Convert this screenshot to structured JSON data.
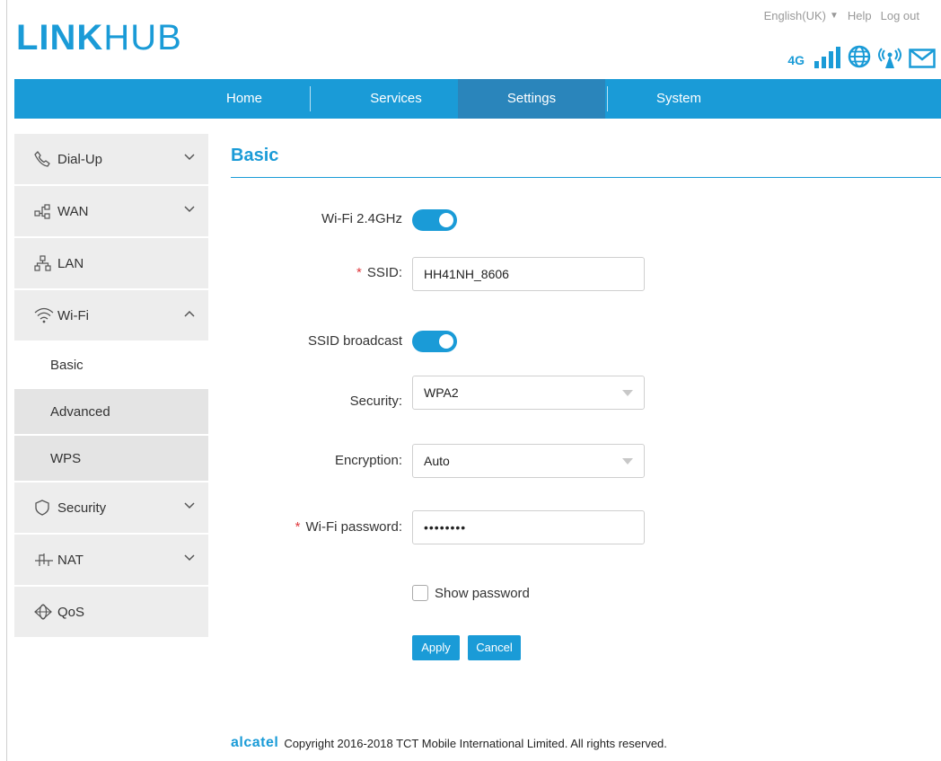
{
  "header": {
    "logo_bold": "LINK",
    "logo_light": "HUB",
    "language": "English(UK)",
    "help": "Help",
    "logout": "Log out",
    "network_type": "4G"
  },
  "nav": {
    "items": [
      {
        "label": "Home"
      },
      {
        "label": "Services"
      },
      {
        "label": "Settings"
      },
      {
        "label": "System"
      }
    ],
    "active": "Settings"
  },
  "sidebar": {
    "items": [
      {
        "label": "Dial-Up",
        "icon": "phone-icon"
      },
      {
        "label": "WAN",
        "icon": "wan-icon"
      },
      {
        "label": "LAN",
        "icon": "lan-icon"
      },
      {
        "label": "Wi-Fi",
        "icon": "wifi-icon"
      },
      {
        "label": "Security",
        "icon": "shield-icon"
      },
      {
        "label": "NAT",
        "icon": "nat-icon"
      },
      {
        "label": "QoS",
        "icon": "qos-icon"
      }
    ],
    "wifi_sub": [
      {
        "label": "Basic"
      },
      {
        "label": "Advanced"
      },
      {
        "label": "WPS"
      }
    ]
  },
  "main": {
    "title": "Basic",
    "wifi_label": "Wi-Fi 2.4GHz",
    "wifi_enabled": true,
    "required_mark": "*",
    "ssid_label": "SSID:",
    "ssid_value": "HH41NH_8606",
    "broadcast_label": "SSID broadcast",
    "broadcast_enabled": true,
    "security_label": "Security:",
    "security_value": "WPA2",
    "encryption_label": "Encryption:",
    "encryption_value": "Auto",
    "password_label": "Wi-Fi password:",
    "password_value": "••••••••",
    "show_password_label": "Show password",
    "apply_label": "Apply",
    "cancel_label": "Cancel"
  },
  "footer": {
    "brand": "alcatel",
    "copyright": "Copyright 2016-2018 TCT Mobile International Limited. All rights reserved."
  },
  "colors": {
    "accent": "#1a9bd7",
    "nav_active": "#2a85bb",
    "required": "#e0393e"
  }
}
